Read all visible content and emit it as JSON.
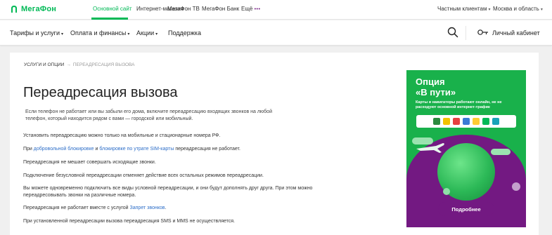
{
  "topbar": {
    "logo_text": "МегаФон",
    "links": [
      "Основной сайт",
      "Интернет-магазин",
      "МегаФон ТВ",
      "МегаФон Банк",
      "Ещё"
    ],
    "more_dots": "•••",
    "segment": "Частным клиентам",
    "region": "Москва и область"
  },
  "nav": {
    "items": [
      "Тарифы и услуги",
      "Оплата и финансы",
      "Акции",
      "Поддержка"
    ],
    "cabinet": "Личный кабинет"
  },
  "breadcrumb": {
    "parent": "Услуги и опции",
    "arrow": "→",
    "current": "Переадресация вызова"
  },
  "page": {
    "title": "Переадресация вызова",
    "lead": "Если телефон не работает или вы забыли его дома, включите переадресацию входящих звонков на любой телефон, который находится рядом с вами — городской или мобильный.",
    "p1": "Установить переадресацию можно только на мобильные и стационарные номера РФ.",
    "p2_before": "При ",
    "p2_link1": "добровольной блокировке",
    "p2_and": " и ",
    "p2_link2": "блокировке по утрате SIM-карты",
    "p2_after": " переадресация не работает.",
    "p3": "Переадресация не мешает совершать исходящие звонки.",
    "p4": "Подключение безусловной переадресации отменяет действие всех остальных режимов переадресации.",
    "p5": "Вы можете одновременно подключить все виды условной переадресации, и они будут дополнять друг друга. При этом можно переадресовывать звонки на различные номера.",
    "p6_before": "Переадресация не работает вместе с услугой ",
    "p6_link": "Запрет звонков",
    "p6_after": ".",
    "p7": "При установленной переадресации вызова переадресация SMS и MMS не осуществляется."
  },
  "banner": {
    "title_line1": "Опция",
    "title_line2": "«В пути»",
    "subtitle": "Карты и навигаторы работают онлайн, не не расходуют основной интернет-трафик",
    "button": "Подробнее"
  },
  "colors": {
    "brand_green": "#00b956",
    "brand_purple": "#731982",
    "link_blue": "#2d6ec8"
  },
  "icons": [
    "megafon-logo-icon",
    "search-icon",
    "key-icon",
    "chevron-down-icon"
  ]
}
